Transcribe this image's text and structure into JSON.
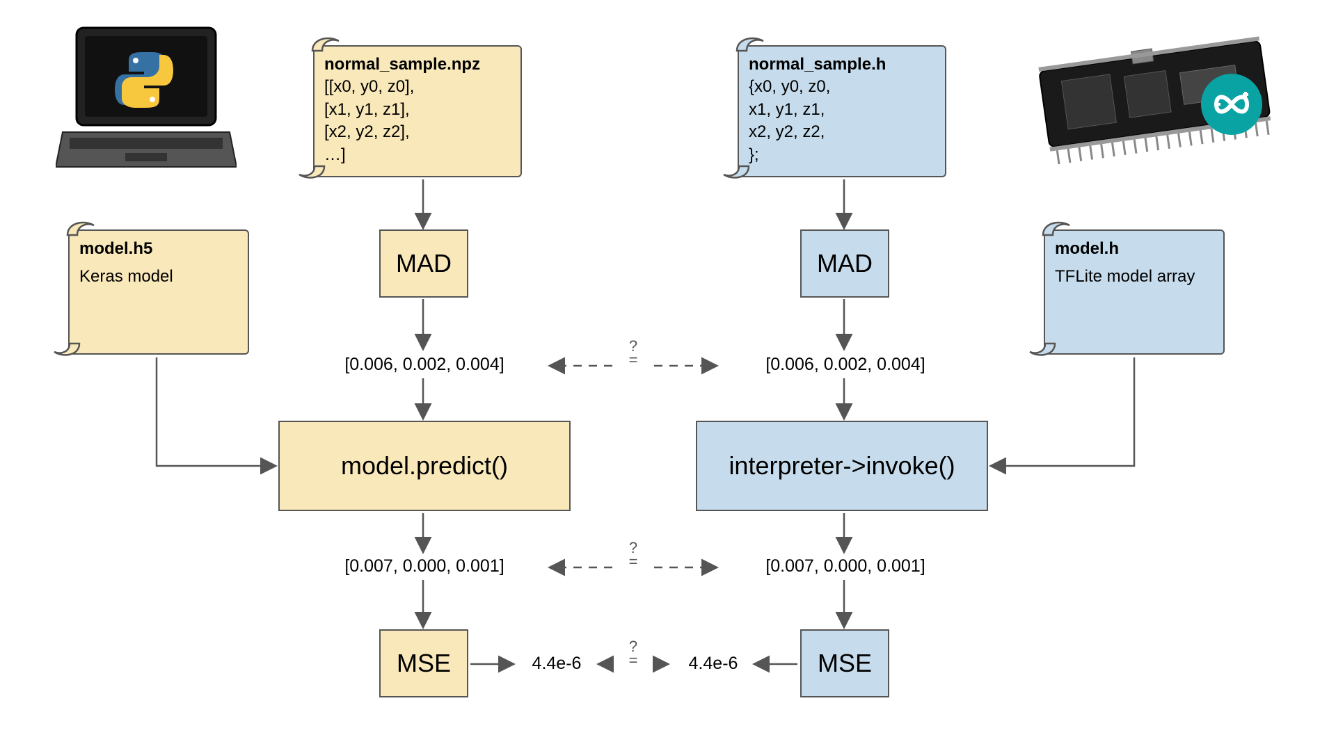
{
  "left": {
    "sample_scroll": {
      "title": "normal_sample.npz",
      "lines": [
        "[[x0, y0, z0],",
        " [x1, y1, z1],",
        " [x2, y2, z2],",
        "…]"
      ]
    },
    "model_scroll": {
      "title": "model.h5",
      "desc": "Keras model"
    },
    "mad_label": "MAD",
    "mad_output": "[0.006, 0.002, 0.004]",
    "predict_label": "model.predict()",
    "predict_output": "[0.007, 0.000, 0.001]",
    "mse_label": "MSE",
    "mse_output": "4.4e-6"
  },
  "right": {
    "sample_scroll": {
      "title": "normal_sample.h",
      "lines": [
        "{x0, y0, z0,",
        " x1, y1, z1,",
        " x2, y2, z2,",
        "};"
      ]
    },
    "model_scroll": {
      "title": "model.h",
      "desc": "TFLite model array"
    },
    "mad_label": "MAD",
    "mad_output": "[0.006, 0.002, 0.004]",
    "invoke_label": "interpreter->invoke()",
    "invoke_output": "[0.007, 0.000, 0.001]",
    "mse_label": "MSE",
    "mse_output": "4.4e-6"
  },
  "compare_symbol_top": "?",
  "compare_symbol_bot": "="
}
